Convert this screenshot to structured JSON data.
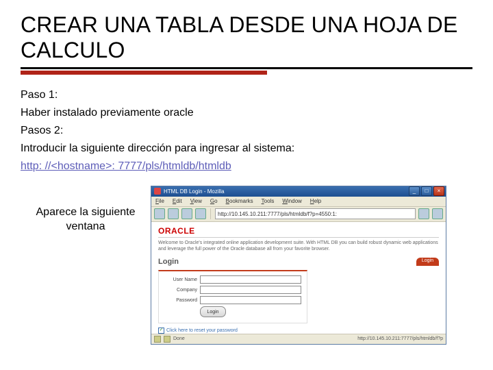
{
  "title": "CREAR UNA TABLA DESDE UNA HOJA DE CALCULO",
  "body": {
    "p1": "Paso 1:",
    "p2": "Haber instalado previamente oracle",
    "p3": "Pasos 2:",
    "p4": "Introducir la siguiente dirección para ingresar al sistema:",
    "url": "http: //<hostname>: 7777/pls/htmldb/htmldb"
  },
  "caption": "Aparece la siguiente ventana",
  "browser": {
    "window_title": "HTML DB Login - Mozilla",
    "menus": {
      "file": "File",
      "edit": "Edit",
      "view": "View",
      "go": "Go",
      "bookmarks": "Bookmarks",
      "tools": "Tools",
      "window": "Window",
      "help": "Help"
    },
    "address": "http://10.145.10.211:7777/pls/htmldb/f?p=4550:1:",
    "logo": "ORACLE",
    "tagline": "Welcome to Oracle's integrated online application development suite. With HTML DB you can build robust dynamic web applications and leverage the full power of the Oracle database all from your favorite browser.",
    "login_header": "Login",
    "tab_label": "Login",
    "fields": {
      "user": "User Name",
      "company": "Company",
      "password": "Password"
    },
    "go_btn": "Login",
    "reset_link": "Click here to reset your password",
    "status_left": "Done",
    "status_right": "http://10.145.10.211:7777/pls/htmldb/f?p"
  }
}
